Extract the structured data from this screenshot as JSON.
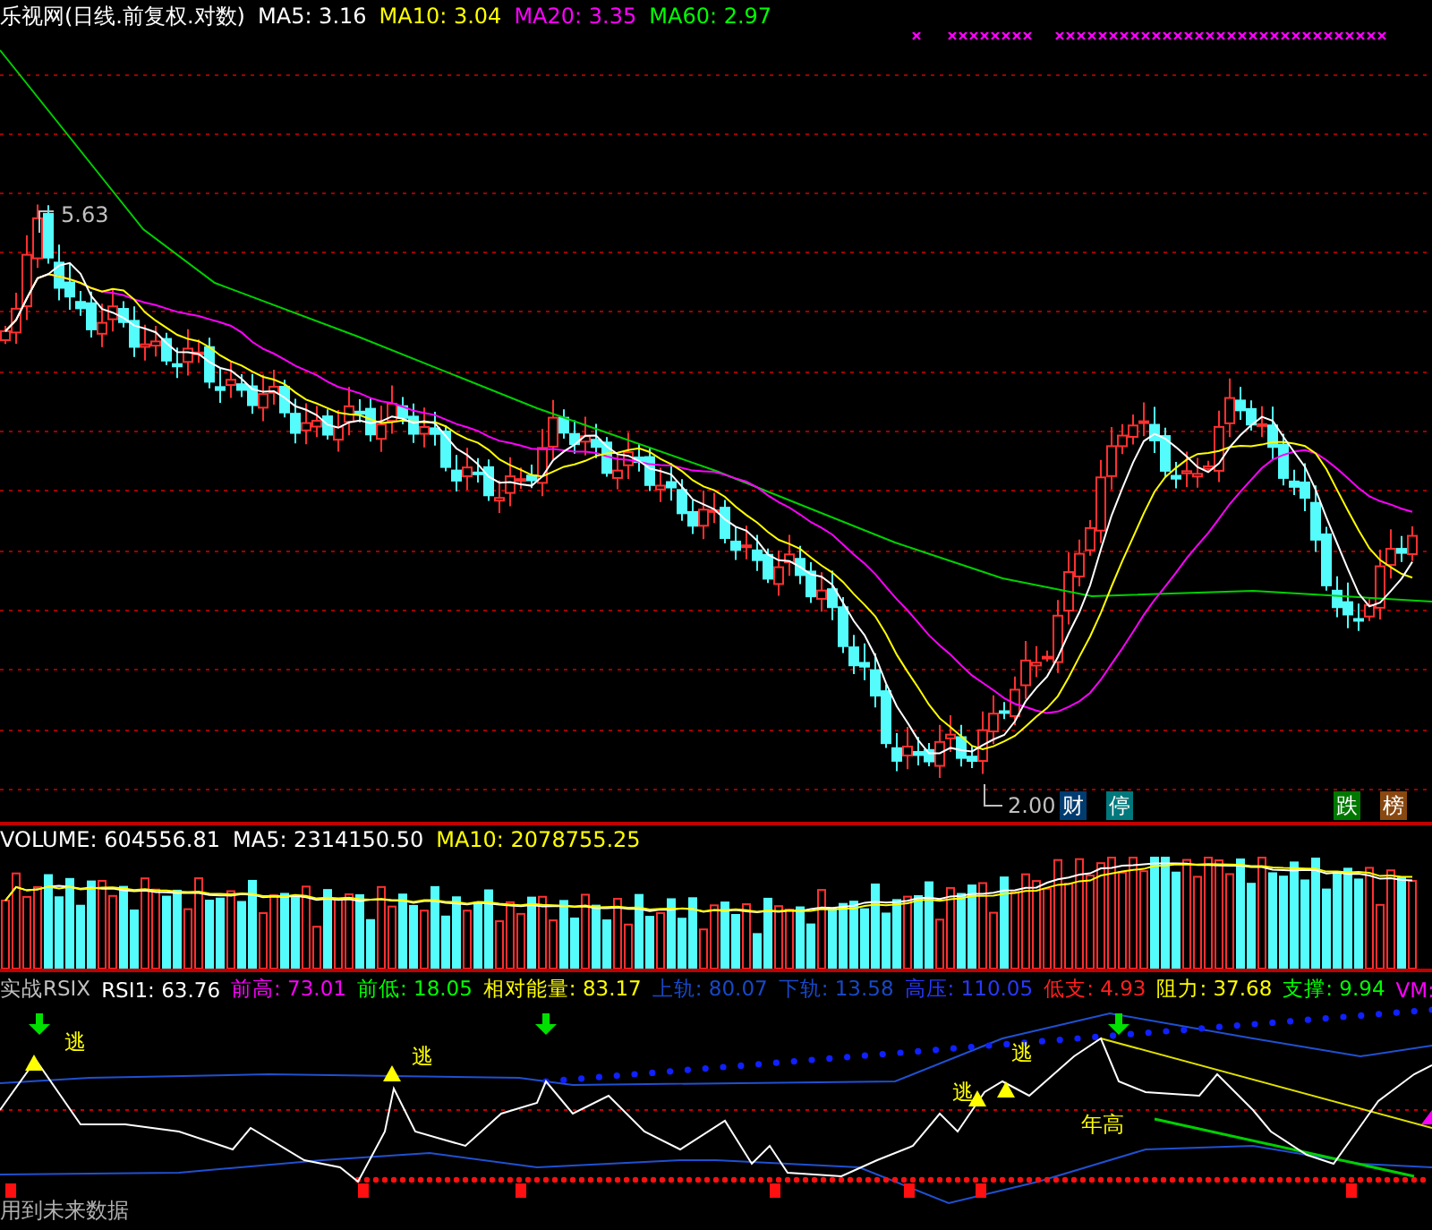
{
  "header": {
    "title": "乐视网(日线.前复权.对数)",
    "ma": [
      {
        "label": "MA5: 3.16",
        "color": "#ffffff"
      },
      {
        "label": "MA10: 3.04",
        "color": "#ffff00"
      },
      {
        "label": "MA20: 3.35",
        "color": "#ff00ff"
      },
      {
        "label": "MA60: 2.97",
        "color": "#00ff00"
      }
    ]
  },
  "main_chart": {
    "high_label": "5.63",
    "low_label": "2.00",
    "badges": [
      {
        "text": "财",
        "color": "#003c70"
      },
      {
        "text": "停",
        "color": "#00787c"
      },
      {
        "text": "跌",
        "color": "#007800"
      },
      {
        "text": "榜",
        "color": "#884810"
      }
    ]
  },
  "volume": {
    "items": [
      {
        "label": "VOLUME: 604556.81",
        "color": "#ffffff"
      },
      {
        "label": "MA5: 2314150.50",
        "color": "#ffffff"
      },
      {
        "label": "MA10: 2078755.25",
        "color": "#ffff00"
      }
    ]
  },
  "indicator": {
    "items": [
      {
        "label": "实战RSIX",
        "color": "#c0c0c0"
      },
      {
        "label": "RSI1: 63.76",
        "color": "#ffffff"
      },
      {
        "label": "前高: 73.01",
        "color": "#ff00ff"
      },
      {
        "label": "前低: 18.05",
        "color": "#00ff00"
      },
      {
        "label": "相对能量: 83.17",
        "color": "#ffff00"
      },
      {
        "label": "上轨: 80.07",
        "color": "#1848c8"
      },
      {
        "label": "下轨: 13.58",
        "color": "#1848c8"
      },
      {
        "label": "高压: 110.05",
        "color": "#2838ff"
      },
      {
        "label": "低支: 4.93",
        "color": "#ff2020"
      },
      {
        "label": "阻力: 37.68",
        "color": "#ffff00"
      },
      {
        "label": "支撑: 9.94",
        "color": "#00ff00"
      },
      {
        "label": "VM:",
        "color": "#ff00ff"
      }
    ],
    "signals": [
      "逃",
      "逃",
      "逃",
      "逃"
    ],
    "year_high": "年高",
    "warning": "用到未来数据"
  }
}
